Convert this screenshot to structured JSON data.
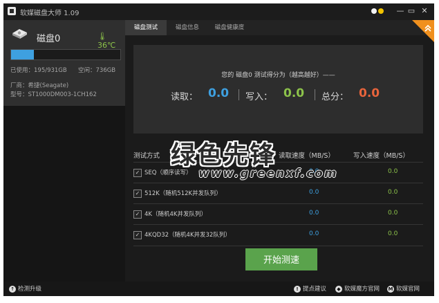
{
  "window": {
    "title": "软媒磁盘大师 1.09"
  },
  "titlebar": {
    "minimize": "—",
    "maximize": "▭",
    "close": "✕"
  },
  "disk": {
    "name": "磁盘0",
    "temperature": "36℃",
    "used_fraction": 0.21,
    "used_label": "已使用：195/931GB",
    "free_label": "空闲：736GB",
    "vendor_label": "厂商：希捷(Seagate)",
    "model_label": "型号：ST1000DM003-1CH162"
  },
  "tabs": [
    {
      "label": "磁盘测试",
      "active": true
    },
    {
      "label": "磁盘信息",
      "active": false
    },
    {
      "label": "磁盘健康度",
      "active": false
    }
  ],
  "score": {
    "caption": "您的 磁盘0 测试得分为（越高越好）——",
    "read_label": "读取：",
    "read_value": "0.0",
    "write_label": "写入：",
    "write_value": "0.0",
    "total_label": "总分：",
    "total_value": "0.0"
  },
  "table": {
    "col_method": "测试方式",
    "col_read": "读取速度（MB/S）",
    "col_write": "写入速度（MB/S）",
    "rows": [
      {
        "label": "SEQ（顺序读写）",
        "read": "0.0",
        "write": "0.0"
      },
      {
        "label": "512K（随机512K并发队列）",
        "read": "0.0",
        "write": "0.0"
      },
      {
        "label": "4K（随机4K并发队列）",
        "read": "0.0",
        "write": "0.0"
      },
      {
        "label": "4KQD32（随机4K并发32队列）",
        "read": "0.0",
        "write": "0.0"
      }
    ]
  },
  "watermark": {
    "cn": "绿色先锋",
    "en": "www.greenxf.com"
  },
  "start_button": "开始测速",
  "statusbar": {
    "check_update": "检测升级",
    "feedback": "提点建议",
    "ruanmei_cube": "软媒魔方官网",
    "ruanmei_site": "软媒官网"
  },
  "colors": {
    "accent_blue": "#3ea0e0",
    "accent_green": "#8cc24a",
    "accent_red": "#e8643c",
    "badge_orange": "#f0901e",
    "button_green": "#5aa34c"
  }
}
